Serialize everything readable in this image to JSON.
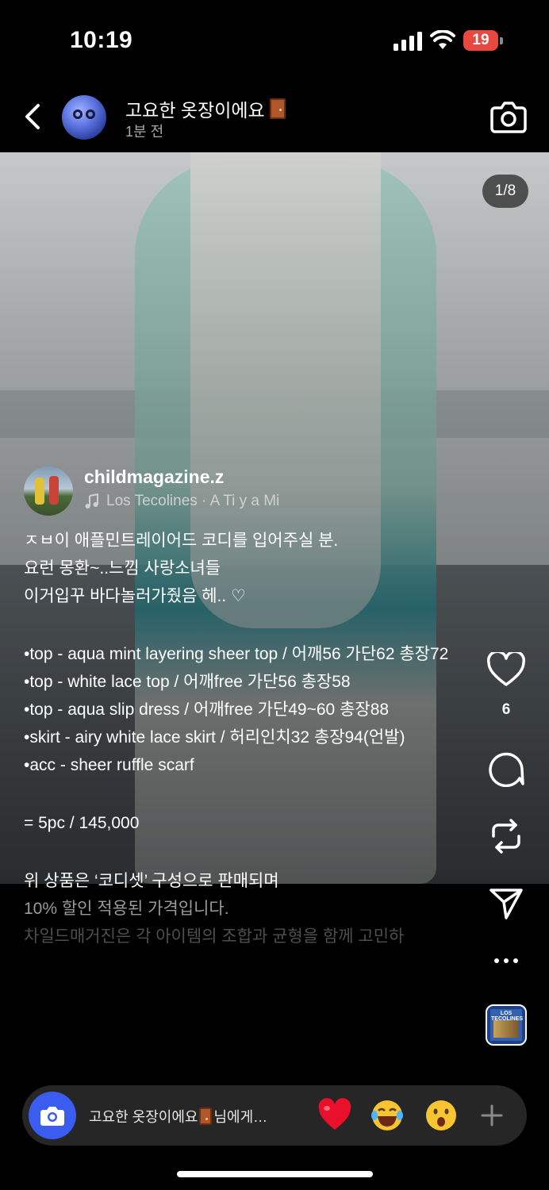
{
  "status_bar": {
    "time": "10:19",
    "battery": "19"
  },
  "header": {
    "name": "고요한 옷장이에요",
    "time_ago": "1분 전"
  },
  "photo": {
    "pager": "1/8"
  },
  "post": {
    "username": "childmagazine.z",
    "song": "Los Tecolines · A Ti y a Mi",
    "caption": {
      "line1": "ㅈㅂ이 애플민트레이어드 코디를 입어주실 분.",
      "line2": "요런 몽환~..느낌 사랑소녀들",
      "line3": "이거입꾸 바다놀러가줬음 헤.. ♡",
      "item1": "•top - aqua mint layering sheer top / 어깨56 가단62 총장72",
      "item2": "•top - white lace top / 어깨free 가단56 총장58",
      "item3": "•top - aqua slip dress / 어깨free 가단49~60 총장88",
      "item4": "•skirt - airy white lace skirt / 허리인치32 총장94(언발)",
      "item5": "•acc - sheer ruffle scarf",
      "price": "= 5pc / 145,000",
      "note1": "위 상품은 ‘코디셋’ 구성으로 판매되며",
      "note2": "10% 할인 적용된 가격입니다.",
      "note3": "차일드매거진은 각 아이템의 조합과 균형을 함께 고민하"
    }
  },
  "actions": {
    "like_count": "6",
    "album_text": "LOS TECOLINES"
  },
  "reply_bar": {
    "placeholder": "고요한 옷장이에요",
    "placeholder_suffix": "님에게…",
    "quick_emojis": [
      "heart",
      "laughing",
      "surprised"
    ]
  },
  "colors": {
    "accent_blue": "#3a5cf0",
    "battery_red": "#e8483f"
  }
}
